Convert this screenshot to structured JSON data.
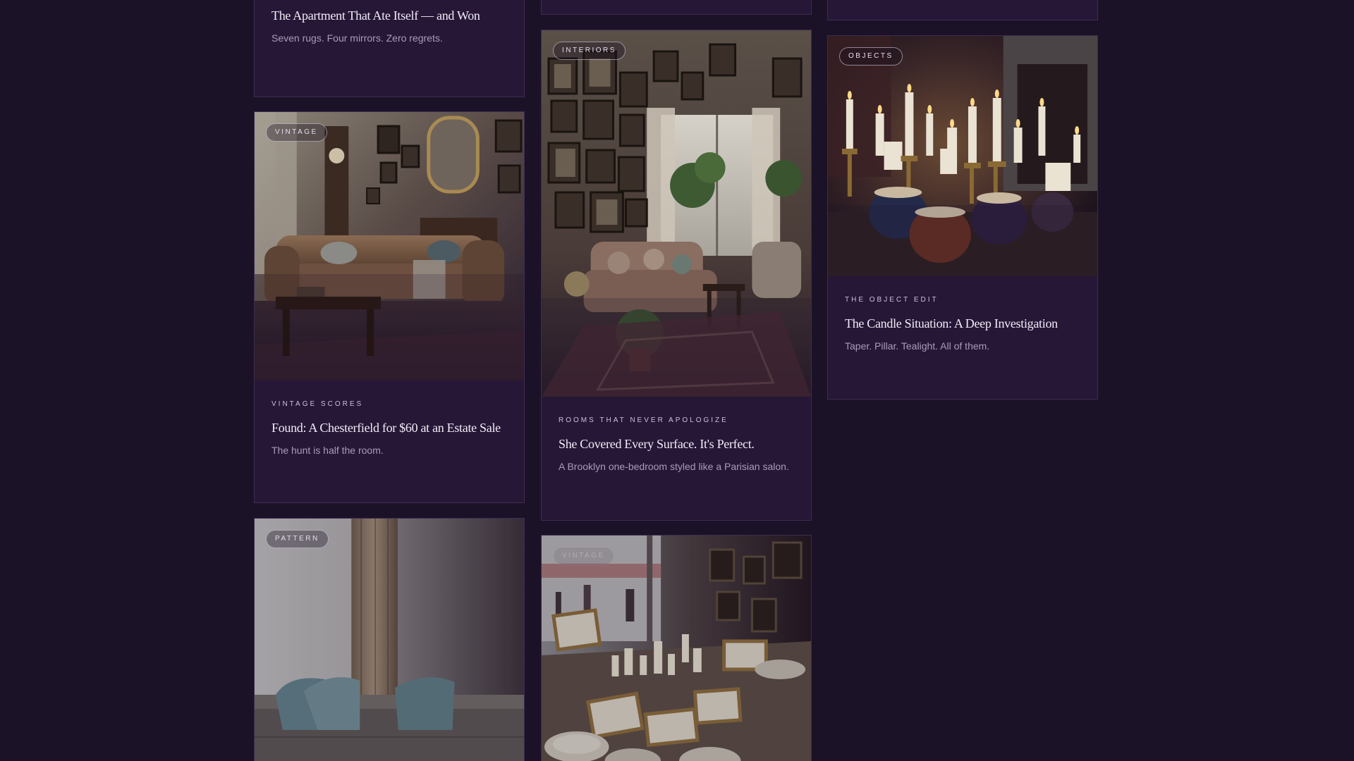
{
  "colors": {
    "background": "#1c1228",
    "card": "#261737",
    "card_border": "#3d2c50",
    "title": "#f2ecf7",
    "kicker": "#cdbfdb",
    "dek": "#a99cb8"
  },
  "cards": {
    "apartment": {
      "title": "The Apartment That Ate Itself — and Won",
      "dek": "Seven rugs. Four mirrors. Zero regrets."
    },
    "chesterfield": {
      "tag": "VINTAGE",
      "kicker": "VINTAGE SCORES",
      "title": "Found: A Chesterfield for $60 at an Estate Sale",
      "dek": "The hunt is half the room."
    },
    "pattern": {
      "tag": "PATTERN"
    },
    "interiors": {
      "tag": "INTERIORS",
      "kicker": "ROOMS THAT NEVER APOLOGIZE",
      "title": "She Covered Every Surface. It's Perfect.",
      "dek": "A Brooklyn one-bedroom styled like a Parisian salon."
    },
    "market": {
      "tag": "VINTAGE"
    },
    "candles": {
      "tag": "OBJECTS",
      "kicker": "THE OBJECT EDIT",
      "title": "The Candle Situation: A Deep Investigation",
      "dek": "Taper. Pillar. Tealight. All of them."
    }
  }
}
